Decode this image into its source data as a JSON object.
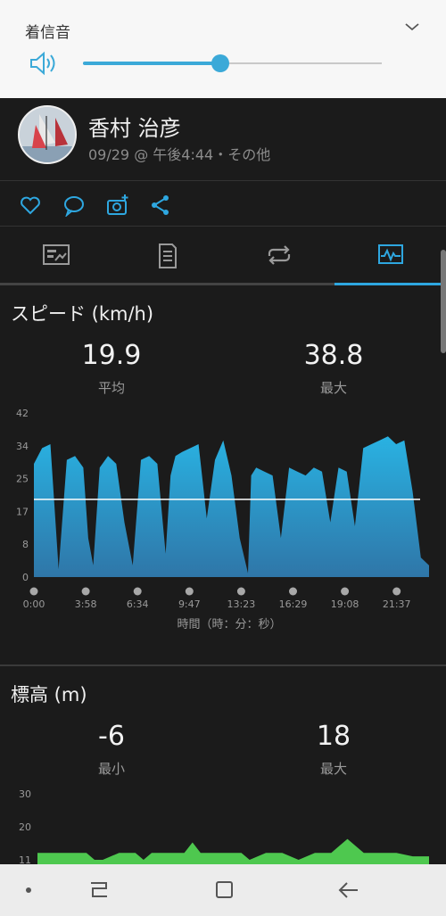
{
  "volume": {
    "title": "着信音",
    "level": 0.46
  },
  "post": {
    "user_name": "香村 治彦",
    "meta": "09/29 @ 午後4:44・その他"
  },
  "actions": {
    "icons": [
      "heart-icon",
      "comment-icon",
      "add-photo-icon",
      "share-icon"
    ]
  },
  "tabs": [
    {
      "icon": "summary-icon",
      "active": false
    },
    {
      "icon": "details-icon",
      "active": false
    },
    {
      "icon": "laps-icon",
      "active": false
    },
    {
      "icon": "charts-icon",
      "active": true
    }
  ],
  "speed": {
    "title": "スピード (km/h)",
    "avg_value": "19.9",
    "avg_label": "平均",
    "max_value": "38.8",
    "max_label": "最大"
  },
  "elevation": {
    "title": "標高 (m)",
    "min_value": "-6",
    "min_label": "最小",
    "max_value": "18",
    "max_label": "最大"
  },
  "colors": {
    "speed_fill_top": "#29b2e2",
    "speed_fill_bottom": "#2f76a8",
    "elevation_fill": "#4ec84f",
    "accent": "#2ea7e0"
  },
  "chart_data": [
    {
      "type": "area",
      "title": "スピード (km/h)",
      "xlabel": "時間（時：分：秒）",
      "ylabel": "",
      "ylim": [
        0,
        42
      ],
      "y_ticks": [
        "42",
        "34",
        "25",
        "17",
        "8",
        "0"
      ],
      "x_ticks": [
        "0:00",
        "3:58",
        "6:34",
        "9:47",
        "13:23",
        "16:29",
        "19:08",
        "21:37"
      ],
      "average_line": 19.9,
      "x_minutes": [
        0,
        0.5,
        1,
        1.5,
        2,
        2.5,
        3,
        3.3,
        3.6,
        4,
        4.5,
        5,
        5.5,
        6,
        6.5,
        7,
        7.5,
        8,
        8.3,
        8.6,
        9,
        9.5,
        10,
        10.5,
        11,
        11.5,
        12,
        12.5,
        13,
        13.2,
        13.5,
        14,
        14.5,
        15,
        15.5,
        16,
        16.5,
        17,
        17.5,
        18,
        18.5,
        19,
        19.5,
        20,
        20.5,
        21,
        21.5,
        22,
        22.5,
        23,
        23.5,
        24
      ],
      "values": [
        29,
        33,
        34,
        2,
        30,
        31,
        28,
        10,
        3,
        28,
        31,
        29,
        14,
        3,
        30,
        31,
        29,
        6,
        26,
        31,
        32,
        33,
        34,
        15,
        30,
        35,
        26,
        10,
        1,
        26,
        28,
        27,
        26,
        10,
        28,
        27,
        26,
        28,
        27,
        14,
        28,
        27,
        13,
        33,
        34,
        35,
        36,
        34,
        35,
        22,
        5,
        3
      ],
      "series": [
        {
          "name": "",
          "values": []
        }
      ]
    },
    {
      "type": "area",
      "title": "標高 (m)",
      "xlabel": "",
      "ylabel": "",
      "y_ticks": [
        "30",
        "20",
        "11"
      ],
      "ylim": [
        11,
        30
      ],
      "x_minutes": [
        0,
        1,
        2,
        3,
        3.5,
        4,
        5,
        6,
        6.5,
        7,
        8,
        9,
        9.5,
        10,
        11,
        12,
        12.5,
        13,
        14,
        15,
        16,
        17,
        17.5,
        18,
        19,
        20,
        21,
        22,
        23,
        24
      ],
      "values": [
        13,
        13,
        13,
        13,
        11,
        11,
        13,
        13,
        11,
        13,
        13,
        13,
        16,
        13,
        13,
        13,
        13,
        11,
        13,
        13,
        11,
        13,
        13,
        13,
        17,
        13,
        13,
        13,
        12,
        12
      ]
    }
  ]
}
